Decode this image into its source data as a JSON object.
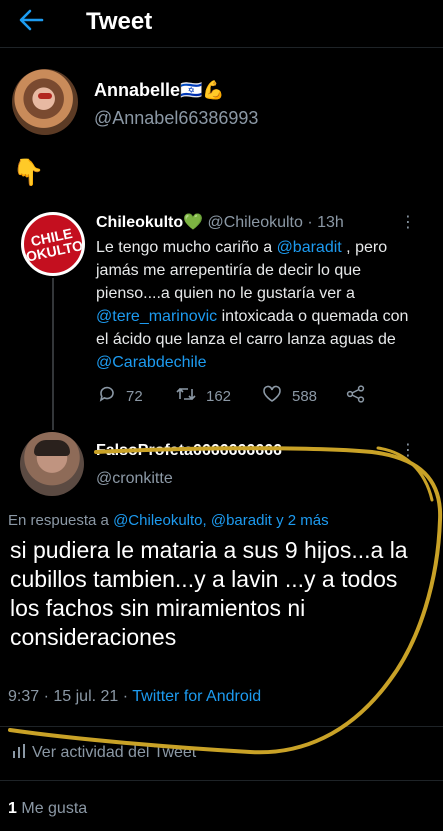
{
  "header": {
    "back_icon": "arrow-left-icon",
    "title": "Tweet"
  },
  "author": {
    "name": "Annabelle🇮🇱💪",
    "handle": "@Annabel66386993",
    "body_emoji": "👇"
  },
  "quoted_tweet": {
    "avatar_text": "CHILE OKULTO",
    "name": "Chileokulto💚",
    "handle": "@Chileokulto",
    "separator": "·",
    "time": "13h",
    "text_parts": {
      "p1": "Le tengo mucho cariño a ",
      "m1": "@baradit",
      "p2": " , pero jamás me arrepentiría de decir lo que pienso....a quien no le gustaría ver a ",
      "m2": "@tere_marinovic",
      "p3": " intoxicada o quemada con el ácido que lanza el carro lanza aguas de ",
      "m3": "@Carabdechile"
    },
    "actions": {
      "replies": "72",
      "retweets": "162",
      "likes": "588"
    }
  },
  "reply_tweet": {
    "name": "FalsoProfeta6666666666",
    "handle": "@cronkitte",
    "replying_prefix": "En respuesta a ",
    "replying_mentions": "@Chileokulto, @baradit",
    "replying_and": " y ",
    "replying_more": "2 más",
    "text": "si pudiera le mataria a sus 9 hijos...a la cubillos tambien...y a lavin ...y a todos los fachos sin miramientos ni consideraciones",
    "time": "9:37",
    "date": "15 jul. 21",
    "source": "Twitter for Android",
    "separator": "·"
  },
  "activity": {
    "label": "Ver actividad del Tweet"
  },
  "likes": {
    "count": "1",
    "label": "Me gusta"
  },
  "colors": {
    "accent": "#1d9bf0",
    "highlight": "#c9a227"
  }
}
